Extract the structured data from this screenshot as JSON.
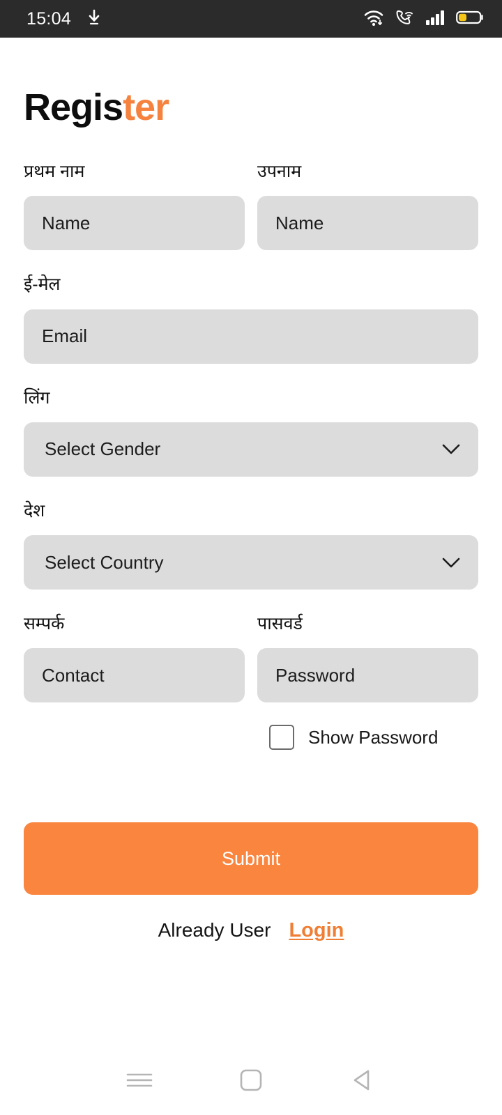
{
  "status_bar": {
    "time": "15:04",
    "download_icon": "download-arrow-icon",
    "wifi_icon": "wifi-icon",
    "wifi_call_icon": "wifi-calling-icon",
    "signal_icon": "cellular-signal-icon",
    "battery_icon": "battery-low-icon",
    "background_color": "#2b2b2b",
    "battery_fill_color": "#f5c518"
  },
  "header": {
    "title_part1": "Regis",
    "title_part2": "ter",
    "accent_color": "#F5833F"
  },
  "form": {
    "first_name": {
      "label": "प्रथम नाम",
      "placeholder": "Name",
      "value": ""
    },
    "last_name": {
      "label": "उपनाम",
      "placeholder": "Name",
      "value": ""
    },
    "email": {
      "label": "ई-मेल",
      "placeholder": "Email",
      "value": ""
    },
    "gender": {
      "label": "लिंग",
      "selected": "Select Gender",
      "chevron": "chevron-down-icon"
    },
    "country": {
      "label": "देश",
      "selected": "Select Country",
      "chevron": "chevron-down-icon"
    },
    "contact": {
      "label": "सम्पर्क",
      "placeholder": "Contact",
      "value": ""
    },
    "password": {
      "label": "पासवर्ड",
      "placeholder": "Password",
      "value": ""
    },
    "show_password": {
      "label": "Show Password",
      "checked": false
    },
    "field_background_color": "#dcdcdc"
  },
  "actions": {
    "submit_label": "Submit",
    "submit_color": "#F9853F",
    "footer_text": "Already User",
    "login_label": "Login",
    "login_color": "#F07F35"
  },
  "nav_bar": {
    "recents_icon": "menu-recents-icon",
    "home_icon": "home-square-icon",
    "back_icon": "back-triangle-icon",
    "icon_color": "#b5b5b5"
  }
}
